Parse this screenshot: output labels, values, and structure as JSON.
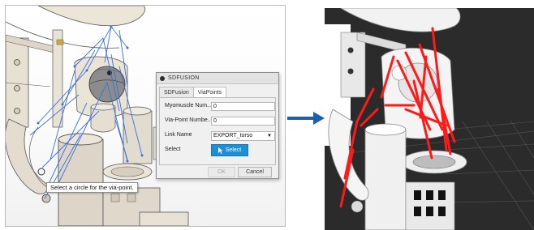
{
  "cad_view": {
    "tooltip": "Select a circle for the via-point."
  },
  "dialog": {
    "title": "SDFUSION",
    "tabs": [
      {
        "label": "SDFusion",
        "active": false
      },
      {
        "label": "ViaPoints",
        "active": true
      }
    ],
    "fields": {
      "myomuscle_label": "Myomuscle Num...",
      "myomuscle_value": "0",
      "viapoint_label": "Via-Point Numbe...",
      "viapoint_value": "0",
      "link_label": "Link Name",
      "link_value": "EXPORT_torso",
      "select_label": "Select",
      "select_button": "Select"
    },
    "ok_label": "OK",
    "cancel_label": "Cancel"
  },
  "colors": {
    "select_button": "#1e8fd6",
    "muscle_lines_cad": "#3d6fe0",
    "muscle_lines_render": "#ff1a1a",
    "arrow": "#1f5ea8",
    "render_background": "#2b2b2b"
  },
  "icons": [
    "cursor-arrow-icon",
    "dropdown-arrow-icon",
    "right-arrow-icon",
    "dialog-dot-icon"
  ]
}
